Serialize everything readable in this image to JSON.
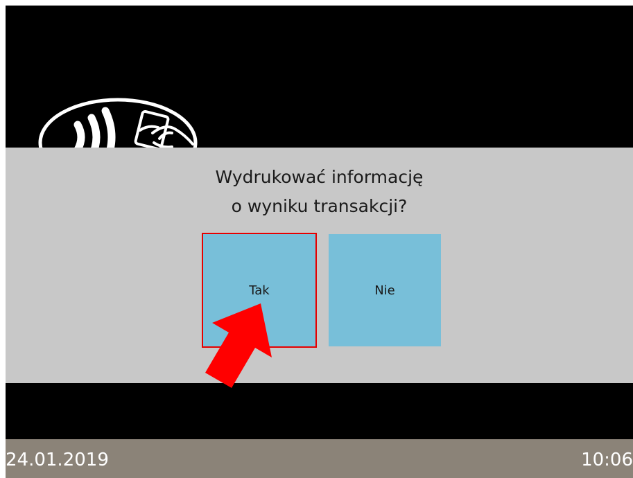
{
  "dialog": {
    "question_line1": "Wydrukować informację",
    "question_line2": "o wyniku transakcji?",
    "yes_label": "Tak",
    "no_label": "Nie"
  },
  "status_bar": {
    "date": "24.01.2019",
    "time": "10:06"
  },
  "colors": {
    "screen_background": "#000000",
    "dialog_background": "#c8c8c8",
    "button_background": "#78bfd9",
    "highlight_border": "#e60000",
    "arrow": "#ff0000",
    "status_bar_background": "#8b8378",
    "status_text": "#ffffff"
  },
  "icons": [
    "contactless-payment-icon",
    "pointer-arrow-icon"
  ]
}
